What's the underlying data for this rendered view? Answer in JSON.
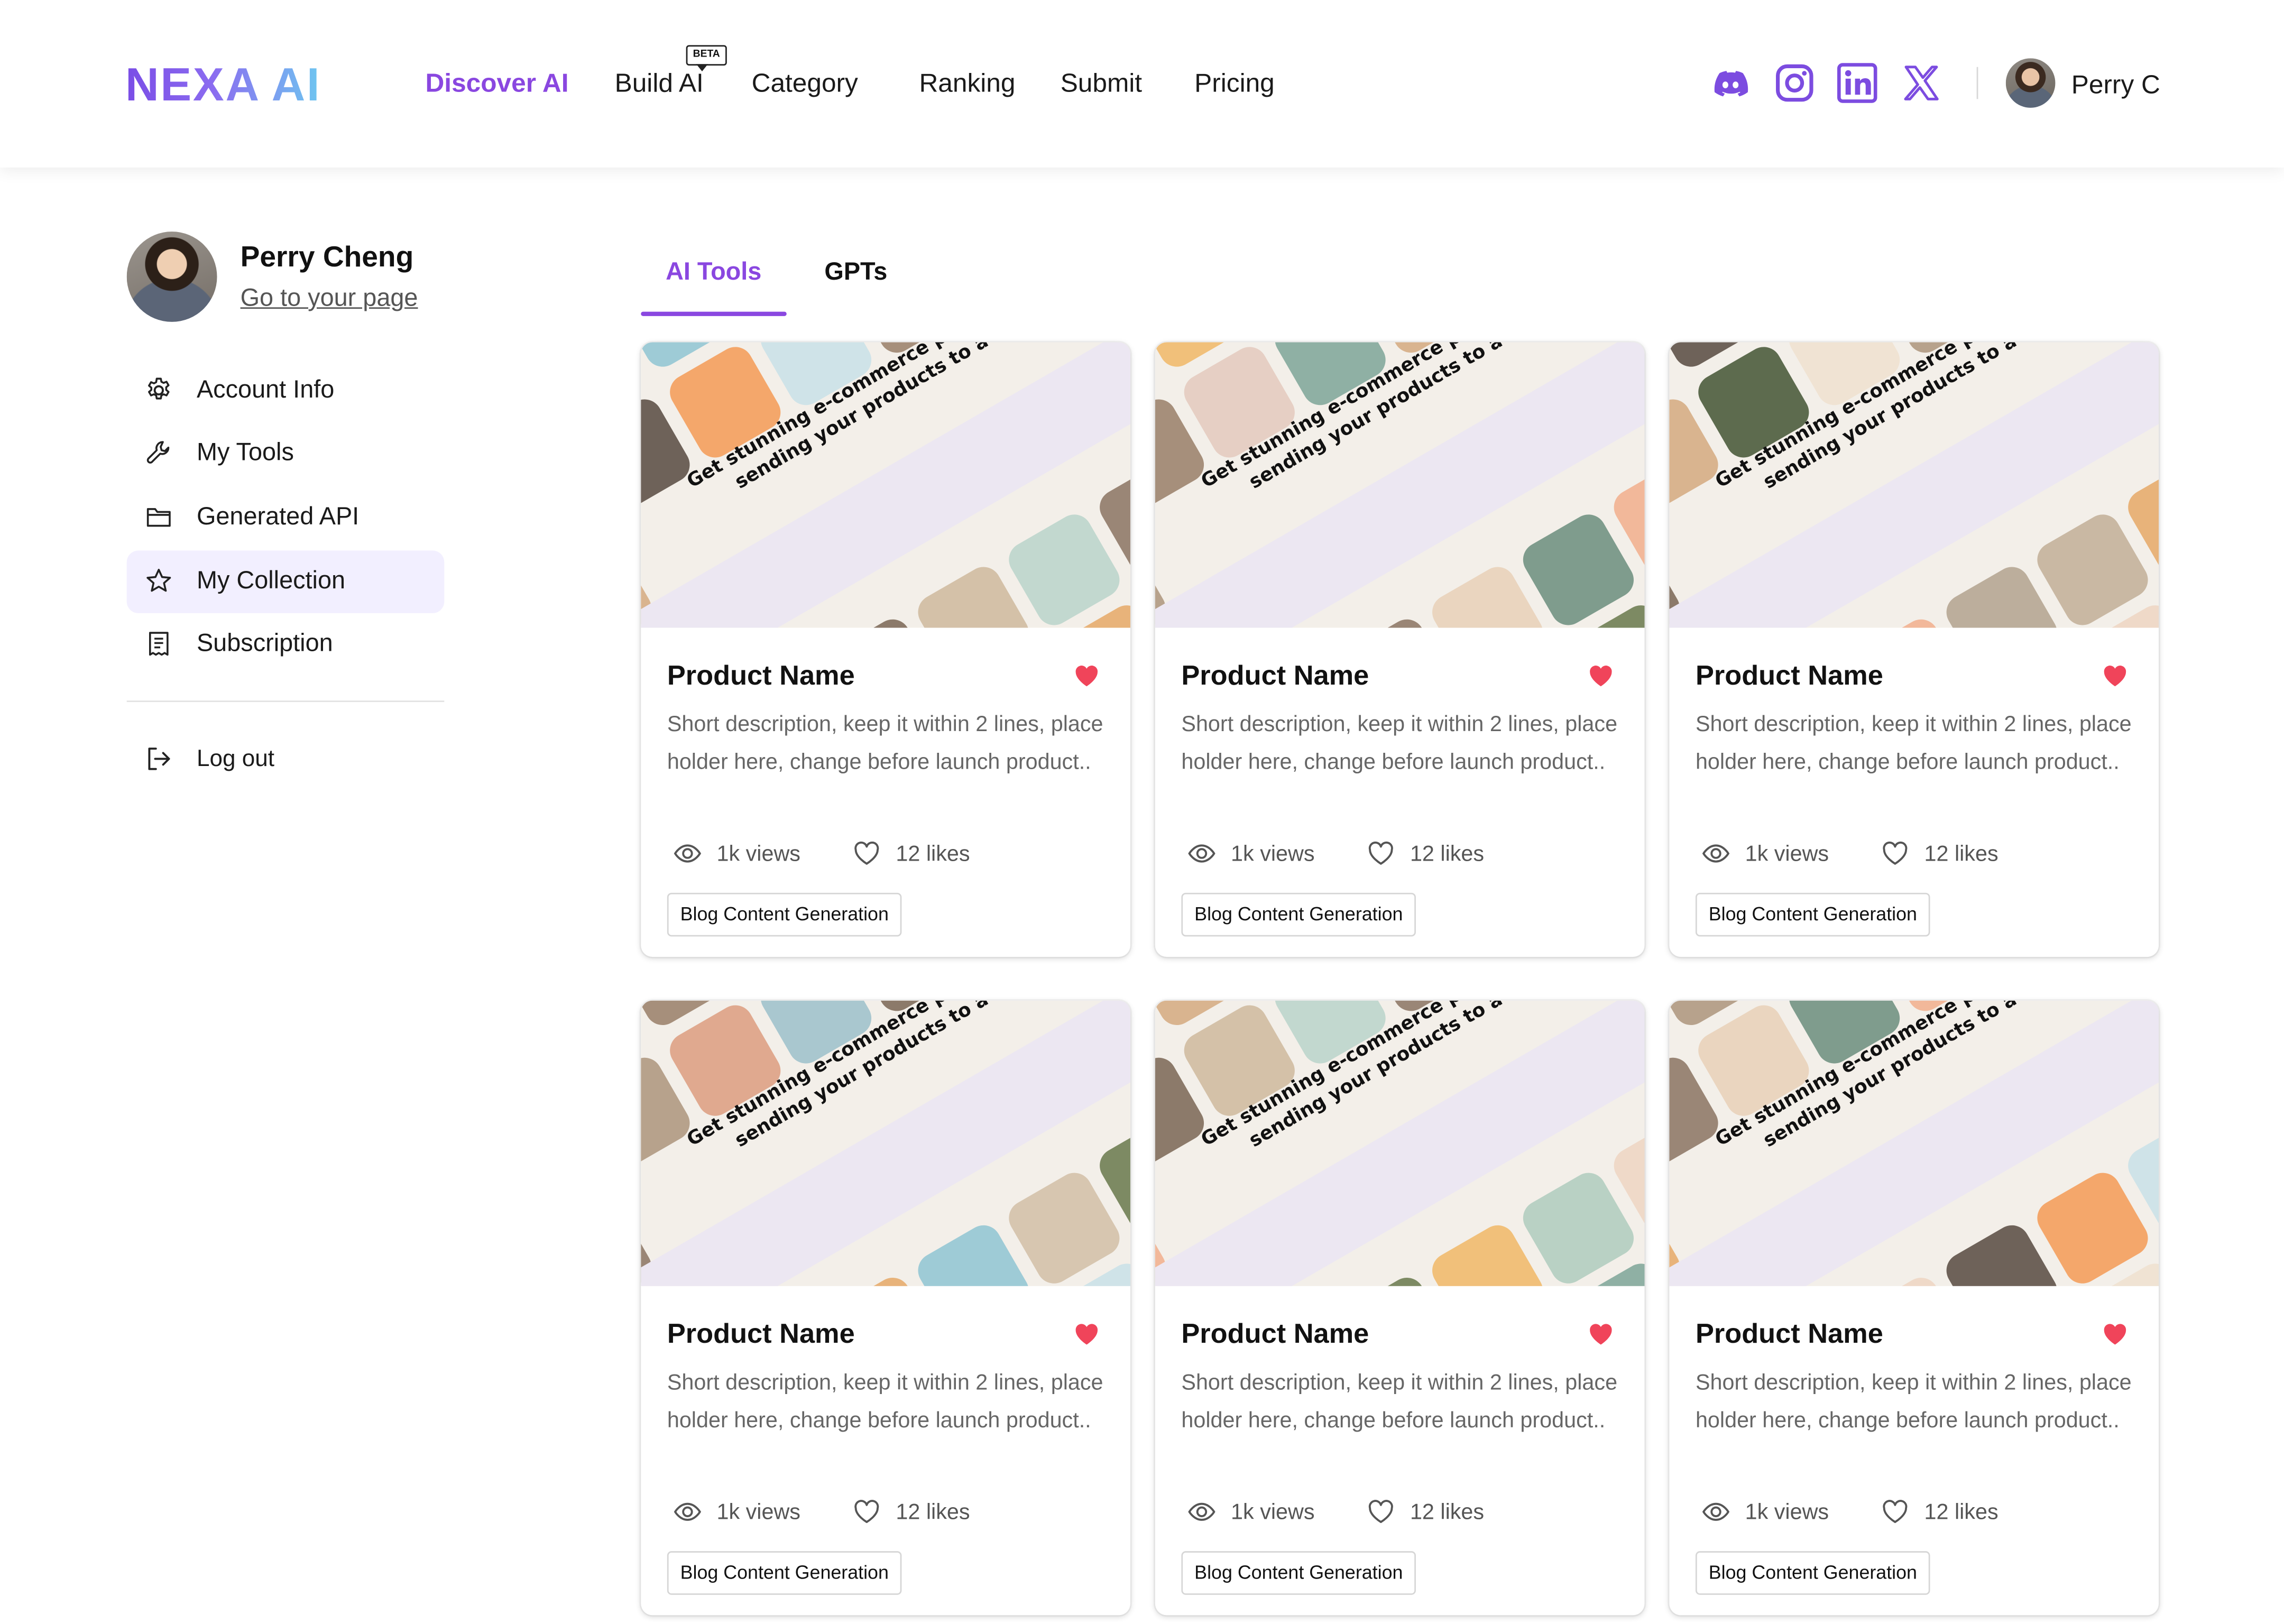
{
  "header": {
    "logo_text": "NEXA AI",
    "nav": [
      {
        "label": "Discover AI",
        "active": true
      },
      {
        "label": "Build AI",
        "badge": "BETA"
      },
      {
        "label": "Category"
      },
      {
        "label": "Ranking"
      },
      {
        "label": "Submit"
      },
      {
        "label": "Pricing"
      }
    ],
    "social_icons": [
      "discord-icon",
      "instagram-icon",
      "linkedin-icon",
      "x-icon"
    ],
    "user_name": "Perry C"
  },
  "sidebar": {
    "profile_name": "Perry Cheng",
    "profile_link": "Go to your page",
    "items": [
      {
        "label": "Account Info",
        "icon": "gear-icon"
      },
      {
        "label": "My Tools",
        "icon": "wrench-icon"
      },
      {
        "label": "Generated API",
        "icon": "folder-icon"
      },
      {
        "label": "My Collection",
        "icon": "star-icon",
        "active": true
      },
      {
        "label": "Subscription",
        "icon": "receipt-icon"
      }
    ],
    "logout_label": "Log out"
  },
  "tabs": [
    {
      "label": "AI Tools",
      "active": true
    },
    {
      "label": "GPTs"
    }
  ],
  "card_image_text": {
    "line1": "Get stunning e-commerce photos without",
    "line2": "sending your products to a studio"
  },
  "cards": [
    {
      "title": "Product Name",
      "description": "Short description, keep it within 2 lines, place holder here, change before launch product..",
      "views": "1k views",
      "likes": "12 likes",
      "tag": "Blog Content Generation",
      "liked": true
    },
    {
      "title": "Product Name",
      "description": "Short description, keep it within 2 lines, place holder here, change before launch product..",
      "views": "1k views",
      "likes": "12 likes",
      "tag": "Blog Content Generation",
      "liked": true
    },
    {
      "title": "Product Name",
      "description": "Short description, keep it within 2 lines, place holder here, change before launch product..",
      "views": "1k views",
      "likes": "12 likes",
      "tag": "Blog Content Generation",
      "liked": true
    },
    {
      "title": "Product Name",
      "description": "Short description, keep it within 2 lines, place holder here, change before launch product..",
      "views": "1k views",
      "likes": "12 likes",
      "tag": "Blog Content Generation",
      "liked": true
    },
    {
      "title": "Product Name",
      "description": "Short description, keep it within 2 lines, place holder here, change before launch product..",
      "views": "1k views",
      "likes": "12 likes",
      "tag": "Blog Content Generation",
      "liked": true
    },
    {
      "title": "Product Name",
      "description": "Short description, keep it within 2 lines, place holder here, change before launch product..",
      "views": "1k views",
      "likes": "12 likes",
      "tag": "Blog Content Generation",
      "liked": true
    }
  ],
  "colors": {
    "accent": "#8a47e0",
    "accent_light": "#f2efff",
    "heart": "#f0445a",
    "social": "#7c4ce0"
  }
}
